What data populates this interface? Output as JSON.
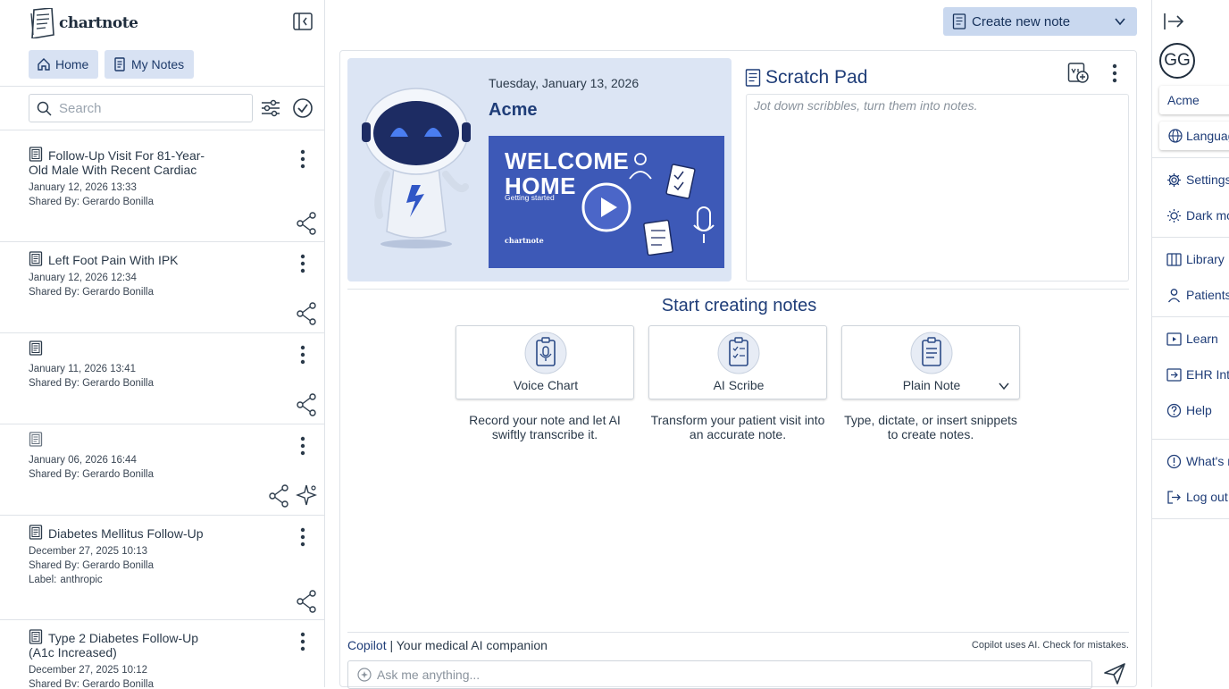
{
  "sidebar": {
    "logo_text": "chartnote",
    "nav": {
      "home": "Home",
      "my_notes": "My Notes"
    },
    "search_placeholder": "Search",
    "notes": [
      {
        "title": "Follow-Up Visit For 81-Year-Old Male With Recent Cardiac",
        "date": "January 12, 2026 13:33",
        "shared_by": "Shared By: Gerardo Bonilla"
      },
      {
        "title": "Left Foot Pain With IPK",
        "date": "January 12, 2026 12:34",
        "shared_by": "Shared By: Gerardo Bonilla"
      },
      {
        "title": "",
        "date": "January 11, 2026 13:41",
        "shared_by": "Shared By: Gerardo Bonilla"
      },
      {
        "title": "",
        "date": "January 06, 2026 16:44",
        "shared_by": "Shared By: Gerardo Bonilla"
      },
      {
        "title": "Diabetes Mellitus Follow-Up",
        "date": "December 27, 2025 10:13",
        "shared_by": "Shared By: Gerardo Bonilla",
        "label_key": "Label:",
        "label_value": "anthropic"
      },
      {
        "title": "Type 2 Diabetes Follow-Up (A1c Increased)",
        "date": "December 27, 2025 10:12",
        "shared_by": "Shared By: Gerardo Bonilla"
      }
    ]
  },
  "topbar": {
    "create_label": "Create new note"
  },
  "welcome": {
    "date": "Tuesday, January 13, 2026",
    "company": "Acme",
    "video_title_1": "WELCOME",
    "video_title_2": "HOME",
    "video_subtitle": "Getting started",
    "video_logo": "chartnote"
  },
  "scratch": {
    "title": "Scratch Pad",
    "placeholder": "Jot down scribbles, turn them into notes."
  },
  "start": {
    "title": "Start creating notes",
    "options": [
      {
        "label": "Voice Chart",
        "desc": "Record your note and let AI swiftly transcribe it."
      },
      {
        "label": "AI Scribe",
        "desc": "Transform your patient visit into an accurate note."
      },
      {
        "label": "Plain Note",
        "desc": "Type, dictate, or insert snippets to create notes."
      }
    ]
  },
  "copilot": {
    "name": "Copilot",
    "tagline": " | Your medical AI companion",
    "disclaimer": "Copilot uses AI. Check for mistakes.",
    "placeholder": "Ask me anything..."
  },
  "rightmenu": {
    "avatar": "GG",
    "org": "Acme",
    "language": "Language",
    "settings": "Settings",
    "dark_mode": "Dark mode",
    "library": "Library",
    "patients": "Patients",
    "learn": "Learn",
    "ehr": "EHR Integrations",
    "help": "Help",
    "whats_new": "What's new",
    "logout": "Log out"
  },
  "colors": {
    "accent": "#1f3d78",
    "nav_bg": "#d8e2f3",
    "create_bg": "#c9d8ef",
    "welcome_bg": "#dce5f4",
    "video_bg": "#3d59b7"
  }
}
